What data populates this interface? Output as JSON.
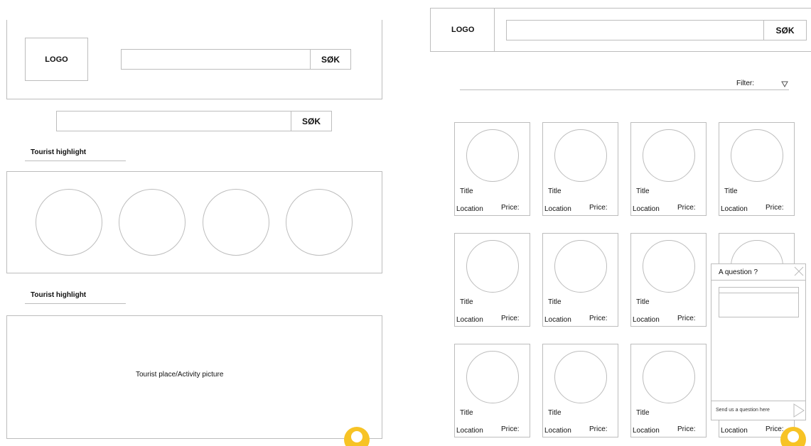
{
  "left": {
    "header": {
      "logo": "LOGO",
      "search_button": "SØK",
      "search_value": ""
    },
    "search": {
      "button": "SØK",
      "value": ""
    },
    "sections": [
      {
        "heading": "Tourist highlight"
      },
      {
        "heading": "Tourist highlight",
        "picture_label": "Tourist place/Activity picture"
      }
    ]
  },
  "right": {
    "header": {
      "logo": "LOGO",
      "search_button": "SØK",
      "search_value": ""
    },
    "filter": {
      "label": "Filter:"
    },
    "card_labels": {
      "title": "Title",
      "location": "Location",
      "price": "Price:"
    },
    "chat": {
      "title": "A question ?",
      "input_placeholder": "Send us a question here"
    }
  },
  "colors": {
    "border": "#bdbdbd",
    "avatar": "#f7c325"
  },
  "icons": {
    "avatar": "user-avatar-icon",
    "close": "close-icon",
    "send": "send-icon",
    "filter": "chevron-down-icon"
  }
}
